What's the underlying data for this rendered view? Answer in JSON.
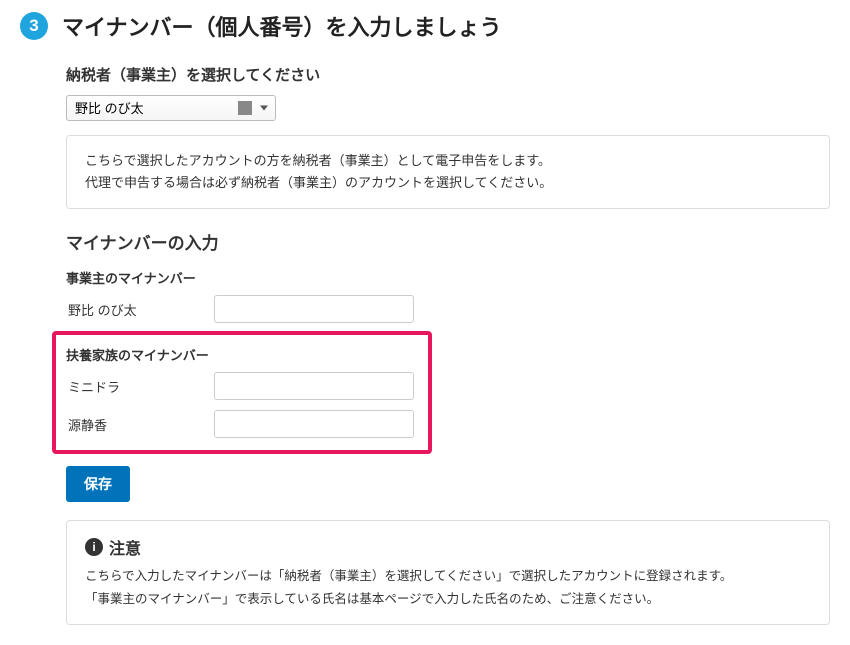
{
  "step": {
    "number": "3",
    "title": "マイナンバー（個人番号）を入力しましょう"
  },
  "taxpayer_select": {
    "label": "納税者（事業主）を選択してください",
    "value": "野比 のび太"
  },
  "info": {
    "line1": "こちらで選択したアカウントの方を納税者（事業主）として電子申告をします。",
    "line2": "代理で申告する場合は必ず納税者（事業主）のアカウントを選択してください。"
  },
  "mynumber": {
    "heading": "マイナンバーの入力",
    "owner_label": "事業主のマイナンバー",
    "owner_name": "野比   のび太",
    "owner_value": "",
    "dependent_label": "扶養家族のマイナンバー",
    "dependents": [
      {
        "name": "ミニドラ",
        "value": ""
      },
      {
        "name": "源静香",
        "value": ""
      }
    ]
  },
  "save_label": "保存",
  "notice": {
    "title": "注意",
    "line1": "こちらで入力したマイナンバーは「納税者（事業主）を選択してください」で選択したアカウントに登録されます。",
    "line2": "「事業主のマイナンバー」で表示している氏名は基本ページで入力した氏名のため、ご注意ください。"
  }
}
